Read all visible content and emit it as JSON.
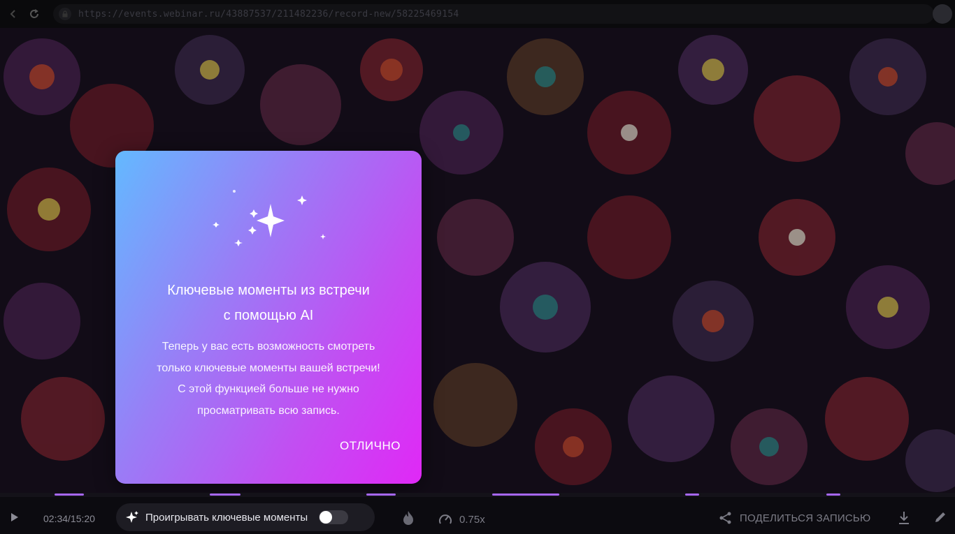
{
  "browser": {
    "url": "https://events.webinar.ru/43887537/211482236/record-new/58225469154",
    "back_icon": "arrow-left-icon",
    "reload_icon": "reload-icon",
    "lock_icon": "lock-icon"
  },
  "popup": {
    "title_line1": "Ключевые моменты из встречи",
    "title_line2": "с помощью AI",
    "body_line1": "Теперь у вас есть возможность смотреть",
    "body_line2": "только ключевые моменты вашей встречи!",
    "body_line3": "С этой функцией больше не нужно",
    "body_line4": "просматривать всю запись.",
    "ok_label": "ОТЛИЧНО",
    "icon": "sparkles-icon",
    "gradient_start": "#63b9ff",
    "gradient_end": "#e028f6"
  },
  "player": {
    "time": "02:34/15:20",
    "highlights_label": "Проигрывать ключевые моменты",
    "highlights_enabled": false,
    "speed": "0.75x",
    "share_label": "ПОДЕЛИТЬСЯ ЗАПИСЬЮ",
    "accent_color": "#a767f5"
  }
}
